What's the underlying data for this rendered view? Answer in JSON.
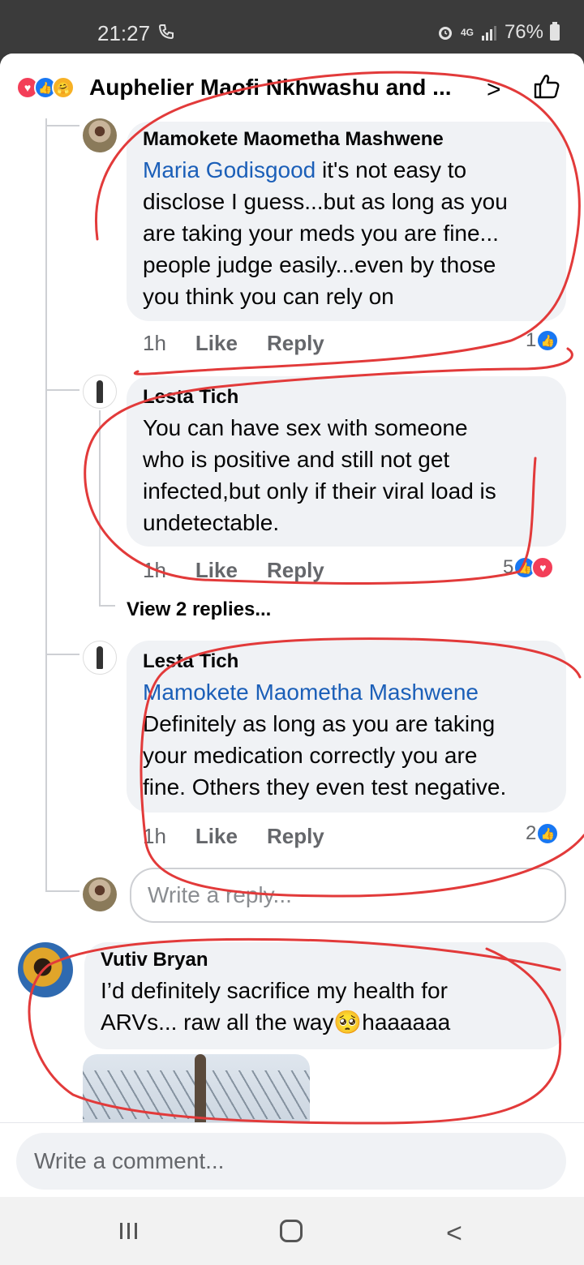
{
  "status_bar": {
    "time": "21:27",
    "network": "4G",
    "battery": "76%"
  },
  "header": {
    "title": "Auphelier Maofi Nkhwashu and ..."
  },
  "comments": [
    {
      "author": "Mamokete Maometha Mashwene",
      "mention": "Maria Godisgood",
      "line1_rest": " it's not easy to",
      "line2": "disclose I guess...but as long as you",
      "line3": "are taking your meds you are fine...",
      "line4": "people judge easily...even by those",
      "line5": "you think you can rely on",
      "time": "1h",
      "like_label": "Like",
      "reply_label": "Reply",
      "reactions": "1"
    },
    {
      "author": "Lesta Tich",
      "line1": "You can have sex with someone",
      "line2": "who is positive and still not get",
      "line3": "infected,but only if their viral load is",
      "line4": "undetectable.",
      "time": "1h",
      "like_label": "Like",
      "reply_label": "Reply",
      "reactions": "5"
    },
    {
      "author": "Lesta Tich",
      "mention": "Mamokete Maometha Mashwene",
      "line1": "Definitely as long as you are taking",
      "line2": "your medication correctly you are",
      "line3": "fine. Others they even test negative.",
      "time": "1h",
      "like_label": "Like",
      "reply_label": "Reply",
      "reactions": "2"
    },
    {
      "author": "Vutiv Bryan",
      "line1": "I’d definitely sacrifice my health for",
      "line2_start": "ARVs... raw all the way",
      "emoji": "🥺",
      "line2_end": "haaaaaa"
    }
  ],
  "view_replies": "View 2 replies...",
  "reply_placeholder": "Write a reply...",
  "comment_placeholder": "Write a comment...",
  "colors": {
    "like_blue": "#1877f2",
    "love_red": "#f33e58",
    "annotation_red": "#e23a3a"
  }
}
